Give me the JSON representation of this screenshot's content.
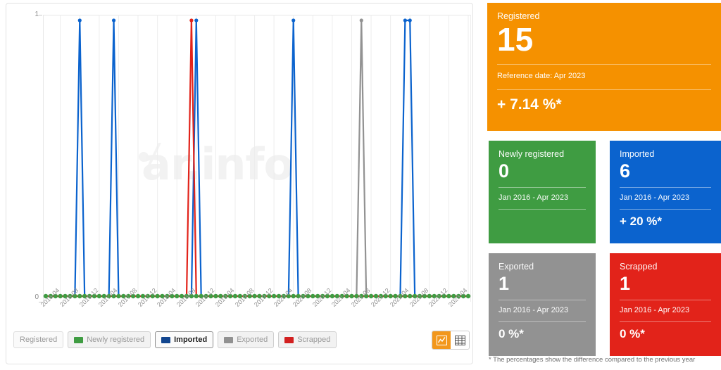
{
  "chart_data": {
    "type": "line",
    "title": "",
    "xlabel": "",
    "ylabel": "",
    "ylim": [
      0,
      1
    ],
    "y_ticks": [
      "1",
      "0"
    ],
    "grid": true,
    "legend_position": "bottom",
    "watermark": "ar.info",
    "x": [
      "2016-01",
      "2016-02",
      "2016-03",
      "2016-04",
      "2016-05",
      "2016-06",
      "2016-07",
      "2016-08",
      "2016-09",
      "2016-10",
      "2016-11",
      "2016-12",
      "2017-01",
      "2017-02",
      "2017-03",
      "2017-04",
      "2017-05",
      "2017-06",
      "2017-07",
      "2017-08",
      "2017-09",
      "2017-10",
      "2017-11",
      "2017-12",
      "2018-01",
      "2018-02",
      "2018-03",
      "2018-04",
      "2018-05",
      "2018-06",
      "2018-07",
      "2018-08",
      "2018-09",
      "2018-10",
      "2018-11",
      "2018-12",
      "2019-01",
      "2019-02",
      "2019-03",
      "2019-04",
      "2019-05",
      "2019-06",
      "2019-07",
      "2019-08",
      "2019-09",
      "2019-10",
      "2019-11",
      "2019-12",
      "2020-01",
      "2020-02",
      "2020-03",
      "2020-04",
      "2020-05",
      "2020-06",
      "2020-07",
      "2020-08",
      "2020-09",
      "2020-10",
      "2020-11",
      "2020-12",
      "2021-01",
      "2021-02",
      "2021-03",
      "2021-04",
      "2021-05",
      "2021-06",
      "2021-07",
      "2021-08",
      "2021-09",
      "2021-10",
      "2021-11",
      "2021-12",
      "2022-01",
      "2022-02",
      "2022-03",
      "2022-04",
      "2022-05",
      "2022-06",
      "2022-07",
      "2022-08",
      "2022-09",
      "2022-10",
      "2022-11",
      "2022-12",
      "2023-01",
      "2023-02",
      "2023-03",
      "2023-04"
    ],
    "x_tick_labels": [
      "2016-04",
      "2016-08",
      "2016-12",
      "2017-04",
      "2017-08",
      "2017-12",
      "2018-04",
      "2018-08",
      "2018-12",
      "2019-04",
      "2019-08",
      "2019-12",
      "2020-04",
      "2020-08",
      "2020-12",
      "2021-04",
      "2021-08",
      "2021-12",
      "2022-04",
      "2022-08",
      "2022-12",
      "2023-04"
    ],
    "series": [
      {
        "name": "Newly registered",
        "color": "#3f9c42",
        "visible": true,
        "spike_indices": [],
        "values_note": "all zero across entire range"
      },
      {
        "name": "Imported",
        "color": "#0b63ce",
        "visible": true,
        "spike_indices": [
          7,
          14,
          31,
          51,
          74,
          75
        ],
        "spike_months": [
          "2016-08",
          "2017-03",
          "2018-08",
          "2020-04",
          "2022-03",
          "2022-04"
        ],
        "spike_value": 1
      },
      {
        "name": "Exported",
        "color": "#929292",
        "visible": true,
        "spike_indices": [
          65
        ],
        "spike_months": [
          "2021-06"
        ],
        "spike_value": 1
      },
      {
        "name": "Scrapped",
        "color": "#e2231a",
        "visible": true,
        "spike_indices": [
          30
        ],
        "spike_months": [
          "2018-07"
        ],
        "spike_value": 1
      },
      {
        "name": "Registered",
        "color": "#f59100",
        "visible": false,
        "spike_indices": []
      }
    ]
  },
  "legend": {
    "items": [
      {
        "label": "Registered",
        "color": "",
        "state": "off-noswatch"
      },
      {
        "label": "Newly registered",
        "color": "#3f9c42",
        "state": "off"
      },
      {
        "label": "Imported",
        "color": "#12468f",
        "state": "active"
      },
      {
        "label": "Exported",
        "color": "#919191",
        "state": "off"
      },
      {
        "label": "Scrapped",
        "color": "#d22020",
        "state": "off"
      }
    ]
  },
  "view_toggle": {
    "chart_icon": "line-chart-icon",
    "table_icon": "table-icon",
    "active": "chart"
  },
  "cards": {
    "registered": {
      "title": "Registered",
      "value": "15",
      "date": "Reference date: Apr 2023",
      "percent": "+ 7.14 %*",
      "color": "#f59100"
    },
    "newly_registered": {
      "title": "Newly registered",
      "value": "0",
      "date": "Jan 2016 - Apr 2023",
      "percent": "",
      "color": "#3f9c42"
    },
    "imported": {
      "title": "Imported",
      "value": "6",
      "date": "Jan 2016 - Apr 2023",
      "percent": "+ 20 %*",
      "color": "#0b63ce"
    },
    "exported": {
      "title": "Exported",
      "value": "1",
      "date": "Jan 2016 - Apr 2023",
      "percent": "0 %*",
      "color": "#929292"
    },
    "scrapped": {
      "title": "Scrapped",
      "value": "1",
      "date": "Jan 2016 - Apr 2023",
      "percent": "0 %*",
      "color": "#e2231a"
    }
  },
  "footnote": "* The percentages show the difference compared to the previous year"
}
